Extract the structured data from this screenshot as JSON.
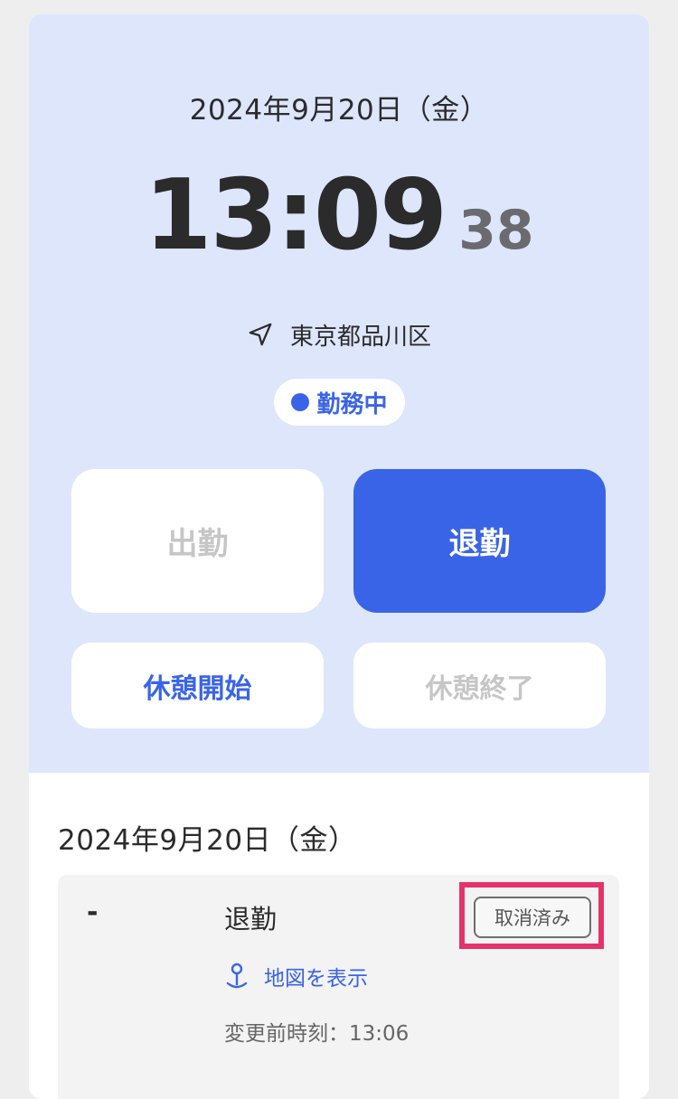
{
  "header": {
    "date": "2024年9月20日（金）",
    "time_hm": "13:09",
    "time_seconds": "38",
    "location": "東京都品川区",
    "status": "勤務中"
  },
  "buttons": {
    "clock_in": "出勤",
    "clock_out": "退勤",
    "break_start": "休憩開始",
    "break_end": "休憩終了"
  },
  "history": {
    "date": "2024年9月20日（金）",
    "records": [
      {
        "time": "-",
        "type": "退勤",
        "badge": "取消済み",
        "map_link": "地図を表示",
        "previous_time": "変更前時刻：13:06"
      }
    ]
  },
  "colors": {
    "accent": "#3a64e8",
    "panel_bg": "#dde6fb",
    "highlight": "#e4336b",
    "disabled_text": "#c6c6c6"
  },
  "icons": {
    "location": "navigation-arrow-icon",
    "status": "status-dot-icon",
    "map": "map-pin-icon"
  }
}
